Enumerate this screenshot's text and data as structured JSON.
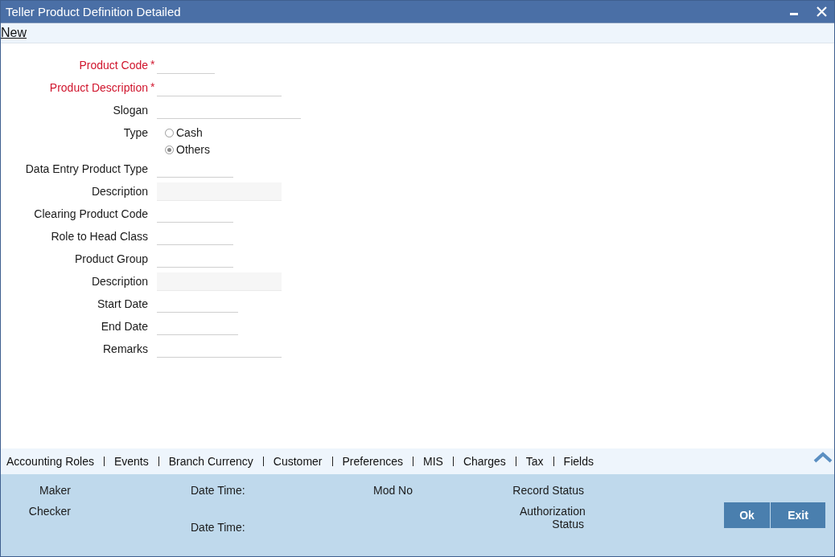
{
  "window": {
    "title": "Teller Product Definition Detailed"
  },
  "toolbar": {
    "new_link": "New"
  },
  "form": {
    "fields": [
      {
        "kind": "text",
        "label": "Product Code",
        "required_mark": "*"
      },
      {
        "kind": "text",
        "label": "Product Description",
        "required_mark": "*"
      },
      {
        "kind": "text",
        "label": "Slogan"
      },
      {
        "kind": "radio",
        "label": "Type",
        "options": [
          {
            "label": "Cash",
            "selected": false
          },
          {
            "label": "Others",
            "selected": true
          }
        ]
      },
      {
        "kind": "text",
        "label": "Data Entry Product Type"
      },
      {
        "kind": "readonly",
        "label": "Description"
      },
      {
        "kind": "text",
        "label": "Clearing Product Code"
      },
      {
        "kind": "text",
        "label": "Role to Head Class"
      },
      {
        "kind": "text",
        "label": "Product Group"
      },
      {
        "kind": "readonly",
        "label": "Description"
      },
      {
        "kind": "text",
        "label": "Start Date"
      },
      {
        "kind": "text",
        "label": "End Date"
      },
      {
        "kind": "text",
        "label": "Remarks"
      }
    ]
  },
  "tabs": [
    "Accounting Roles",
    "Events",
    "Branch Currency",
    "Customer",
    "Preferences",
    "MIS",
    "Charges",
    "Tax",
    "Fields"
  ],
  "footer": {
    "maker": "Maker",
    "checker": "Checker",
    "date_time_1": "Date Time:",
    "date_time_2": "Date Time:",
    "mod_no": "Mod No",
    "record_status": "Record Status",
    "authorization_status": "Authorization Status"
  },
  "buttons": [
    "Ok",
    "Exit"
  ]
}
